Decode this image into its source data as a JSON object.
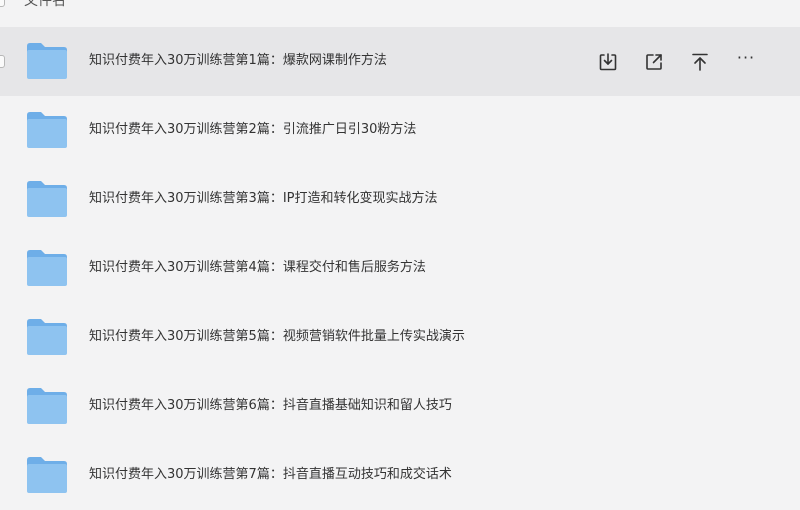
{
  "header": {
    "column_name": "文件名"
  },
  "files": [
    {
      "name": "知识付费年入30万训练营第1篇：爆款网课制作方法",
      "hovered": true
    },
    {
      "name": "知识付费年入30万训练营第2篇：引流推广日引30粉方法",
      "hovered": false
    },
    {
      "name": "知识付费年入30万训练营第3篇：IP打造和转化变现实战方法",
      "hovered": false
    },
    {
      "name": "知识付费年入30万训练营第4篇：课程交付和售后服务方法",
      "hovered": false
    },
    {
      "name": "知识付费年入30万训练营第5篇：视频营销软件批量上传实战演示",
      "hovered": false
    },
    {
      "name": "知识付费年入30万训练营第6篇：抖音直播基础知识和留人技巧",
      "hovered": false
    },
    {
      "name": "知识付费年入30万训练营第7篇：抖音直播互动技巧和成交话术",
      "hovered": false
    }
  ],
  "row_actions": {
    "more_label": "···"
  },
  "icons": {
    "folder": "folder-icon",
    "download": "download-icon",
    "share": "share-icon",
    "pin_top": "pin-to-top-icon",
    "more": "more-icon"
  },
  "colors": {
    "folder_body": "#8ec3f0",
    "folder_tab": "#6eaee8",
    "hover_row": "#e6e6e8",
    "background": "#f3f3f4"
  }
}
